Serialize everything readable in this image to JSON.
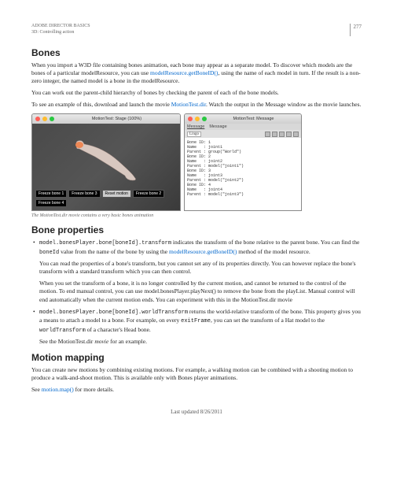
{
  "header": {
    "title": "ADOBE DIRECTOR BASICS",
    "subtitle": "3D: Controlling action",
    "page": "277"
  },
  "sections": {
    "bones": {
      "heading": "Bones",
      "p1a": "When you import a W3D file containing bones animation, each bone may appear as a separate model. To discover which models are the bones of a particular modelResource, you can use ",
      "p1link": "modelResource.getBoneID()",
      "p1b": ", using the name of each model in turn. If the result is a non-zero integer, the named model is a bone in the modelResource.",
      "p2": "You can work out the parent-child hierarchy of bones by checking the parent of each of the bone models.",
      "p3a": "To see an example of this, download and launch the movie ",
      "p3link": "MotionTest.dir",
      "p3b": ". Watch the output in the Message window as the movie launches."
    },
    "figure": {
      "stage_title": "MotionTest: Stage (100%)",
      "msg_title": "MotionTest: Message",
      "msg_tab1": "Message",
      "msg_tab2": "Message",
      "msg_select": "Lingo",
      "btn1": "Freeze bone 1",
      "btn2": "Freeze bone 3",
      "btn3": "Reset motion",
      "btn4": "Freeze bone 2",
      "btn5": "Freeze bone 4",
      "console": "Bone ID: 1\nName   : joint1\nParent : group(\"World\")\nBone ID: 2\nName   : joint2\nParent : model(\"joint1\")\nBone ID: 3\nName   : joint3\nParent : model(\"joint2\")\nBone ID: 4\nName   : joint4\nParent : model(\"joint3\")",
      "caption": "The MotionTest.dir movie contains a very basic bones animation"
    },
    "boneprops": {
      "heading": "Bone properties",
      "li1a": "model.bonesPlayer.bone[boneId].transform",
      "li1b": " indicates the transform of the bone relative to the parent bone. You can find the ",
      "li1c": "boneId",
      "li1d": " value from the name of the bone by using the ",
      "li1link": "modelResource.getBoneID()",
      "li1e": " method of the model resource.",
      "li1p2": "You can read the properties of a bone's transform, but you cannot set any of its properties directly. You can however replace the bone's transform with a standard transform which you can then control.",
      "li1p3": "When you set the transform of a bone, it is no longer controlled by the current motion, and cannot be returned to the control of the motion. To end manual control, you can use model.bonesPlayer.playNext() to remove the bone from the playList. Manual control will end automatically when the current motion ends. You can experiment with this in the MotionTest.dir movie",
      "li2a": "model.bonesPlayer.bone[boneId].worldTransform",
      "li2b": " returns the world-relative transform of the bone. This property gives you a means to attach a model to a bone. For example, on every ",
      "li2c": "exitFrame",
      "li2d": ", you can set the transform of a Hat model to the ",
      "li2e": "worldTransform",
      "li2f": " of a character's Head bone.",
      "li2p2a": "See the MotionTest.dir ",
      "li2p2b": "movie",
      "li2p2c": " for an example."
    },
    "motion": {
      "heading": "Motion mapping",
      "p1": "You can create new motions by combining existing motions. For example, a walking motion can be combined with a shooting motion to produce a walk-and-shoot motion. This is available only with Bones player animations.",
      "p2a": "See ",
      "p2link": "motion.map()",
      "p2b": " for more details."
    }
  },
  "footer": "Last updated 8/26/2011"
}
